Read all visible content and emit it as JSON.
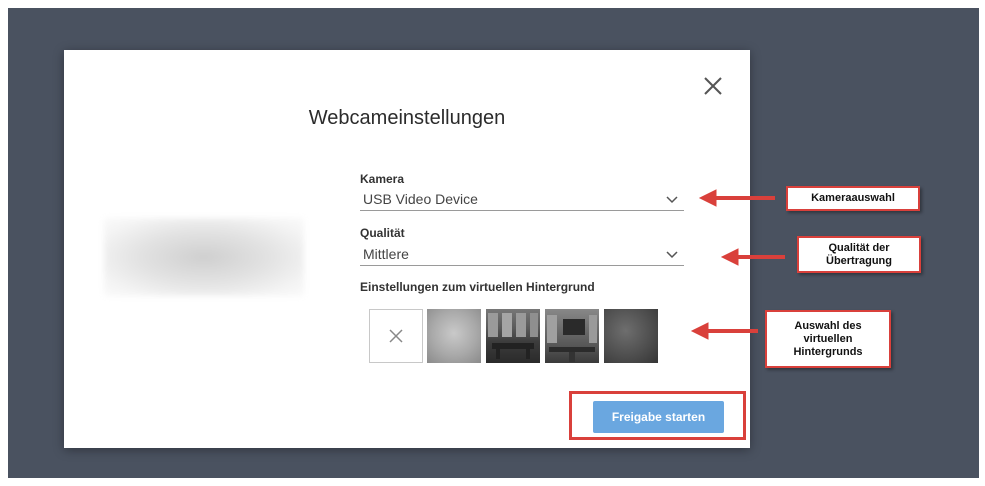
{
  "dialog": {
    "title": "Webcameinstellungen",
    "close_icon": "close-icon"
  },
  "camera": {
    "label": "Kamera",
    "value": "USB Video Device"
  },
  "quality": {
    "label": "Qualität",
    "value": "Mittlere"
  },
  "background": {
    "label": "Einstellungen zum virtuellen Hintergrund",
    "options": [
      "none-icon",
      "blur",
      "office-1",
      "office-2",
      "dark-texture"
    ]
  },
  "submit_label": "Freigabe starten",
  "annotations": {
    "camera": "Kameraauswahl",
    "quality": "Qualität der Übertragung",
    "background": "Auswahl des virtuellen Hintergrunds"
  },
  "colors": {
    "backdrop": "#4a5260",
    "accent": "#6aa7e0",
    "annotation": "#d9403b"
  }
}
